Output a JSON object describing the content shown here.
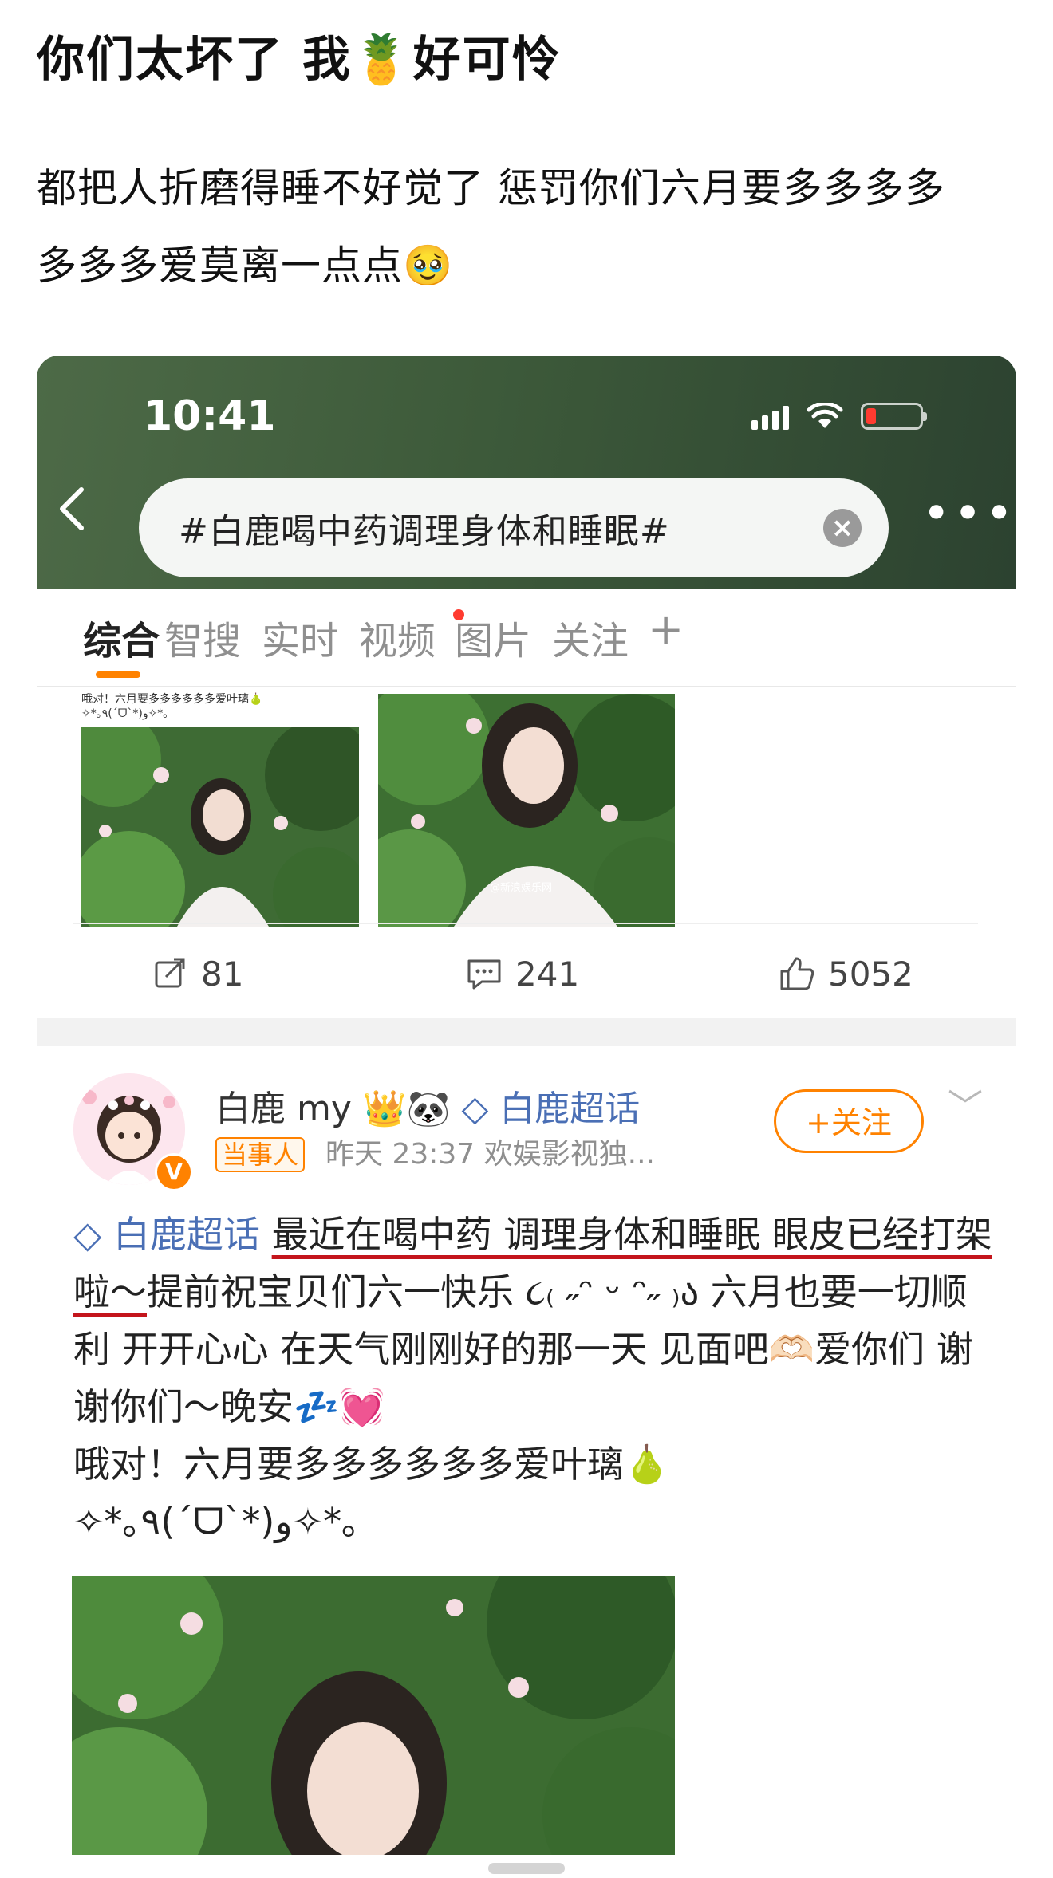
{
  "post": {
    "title": "你们太坏了 我🍍好可怜",
    "body_line1": "都把人折磨得睡不好觉了 惩罚你们六月要多多多多",
    "body_line2": "多多多爱莫离一点点🥹"
  },
  "phone": {
    "status_time": "10:41",
    "icons": {
      "signal": "signal-icon",
      "wifi": "wifi-icon",
      "battery": "battery-icon",
      "back": "back-icon",
      "clear": "clear-icon",
      "more": "more-icon"
    },
    "search_text": "#白鹿喝中药调理身体和睡眠#",
    "tabs": [
      "综合",
      "智搜",
      "实时",
      "视频",
      "图片",
      "关注"
    ],
    "add_tab": "+"
  },
  "prev_post": {
    "snippet_line1": "哦对！六月要多多多多多多爱叶璃🍐",
    "snippet_line2": "✧*｡٩(ˊᗜˋ*)و✧*｡",
    "watermark": "@新浪娱乐网",
    "repost_count": "81",
    "comment_count": "241",
    "like_count": "5052"
  },
  "card": {
    "username": "白鹿 my",
    "badges": "👑🐼",
    "supertopic_link": "白鹿超话",
    "tag": "当事人",
    "meta": "昨天 23:37  欢娱影视独...",
    "follow_label": "+关注",
    "content_topic": "白鹿超话",
    "content_underlined": "最近在喝中药 调理身体和睡眠 眼皮已经打架啦～",
    "content_rest1": "提前祝宝贝们六一快乐 ૮₍ ˶ᵔ ᵕ ᵔ˶ ₎ა 六月也要一切顺利 开开心心 在天气刚刚好的那一天 见面吧🫶🏻爱你们 谢谢你们～晚安💤💓",
    "content_line2": "哦对！六月要多多多多多多爱叶璃🍐",
    "content_line3": "✧*｡٩(ˊᗜˋ*)و✧*｡"
  },
  "colors": {
    "accent": "#ff8200",
    "topic": "#4a6fb5",
    "underline": "#c4151c",
    "header": "#3d5a3a"
  }
}
